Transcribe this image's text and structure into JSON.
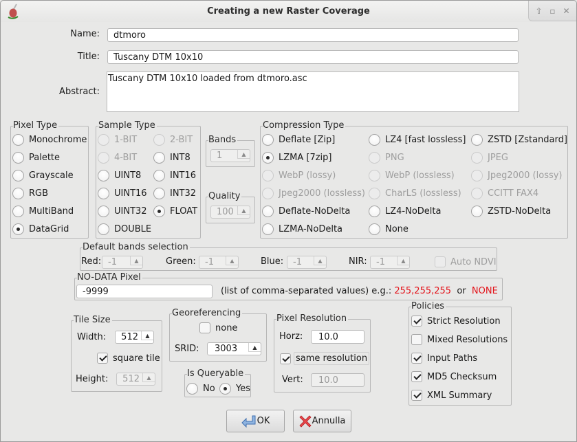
{
  "window": {
    "title": "Creating a new Raster Coverage",
    "controls": [
      "up-icon",
      "maximize-icon",
      "close-icon"
    ]
  },
  "form": {
    "name_label": "Name:",
    "name_value": "dtmoro",
    "title_label": "Title:",
    "title_value": "Tuscany DTM 10x10",
    "abstract_label": "Abstract:",
    "abstract_value": "Tuscany DTM 10x10 loaded from dtmoro.asc"
  },
  "pixel_type": {
    "legend": "Pixel Type",
    "options": [
      {
        "label": "Monochrome",
        "selected": false,
        "enabled": true
      },
      {
        "label": "Palette",
        "selected": false,
        "enabled": true
      },
      {
        "label": "Grayscale",
        "selected": false,
        "enabled": true
      },
      {
        "label": "RGB",
        "selected": false,
        "enabled": true
      },
      {
        "label": "MultiBand",
        "selected": false,
        "enabled": true
      },
      {
        "label": "DataGrid",
        "selected": true,
        "enabled": true
      }
    ]
  },
  "sample_type": {
    "legend": "Sample Type",
    "options": [
      {
        "label": "1-BIT",
        "selected": false,
        "enabled": false
      },
      {
        "label": "2-BIT",
        "selected": false,
        "enabled": false
      },
      {
        "label": "4-BIT",
        "selected": false,
        "enabled": false
      },
      {
        "label": "INT8",
        "selected": false,
        "enabled": true
      },
      {
        "label": "UINT8",
        "selected": false,
        "enabled": true
      },
      {
        "label": "INT16",
        "selected": false,
        "enabled": true
      },
      {
        "label": "UINT16",
        "selected": false,
        "enabled": true
      },
      {
        "label": "INT32",
        "selected": false,
        "enabled": true
      },
      {
        "label": "UINT32",
        "selected": false,
        "enabled": true
      },
      {
        "label": "FLOAT",
        "selected": true,
        "enabled": true
      },
      {
        "label": "DOUBLE",
        "selected": false,
        "enabled": true
      }
    ]
  },
  "bands": {
    "legend": "Bands",
    "value": "1"
  },
  "quality": {
    "legend": "Quality",
    "value": "100"
  },
  "compression": {
    "legend": "Compression Type",
    "options": [
      {
        "label": "Deflate [Zip]",
        "selected": false,
        "enabled": true
      },
      {
        "label": "LZ4 [fast lossless]",
        "selected": false,
        "enabled": true
      },
      {
        "label": "ZSTD [Zstandard]",
        "selected": false,
        "enabled": true
      },
      {
        "label": "LZMA [7zip]",
        "selected": true,
        "enabled": true
      },
      {
        "label": "PNG",
        "selected": false,
        "enabled": false
      },
      {
        "label": "JPEG",
        "selected": false,
        "enabled": false
      },
      {
        "label": "WebP (lossy)",
        "selected": false,
        "enabled": false
      },
      {
        "label": "WebP (lossless)",
        "selected": false,
        "enabled": false
      },
      {
        "label": "Jpeg2000 (lossy)",
        "selected": false,
        "enabled": false
      },
      {
        "label": "Jpeg2000 (lossless)",
        "selected": false,
        "enabled": false
      },
      {
        "label": "CharLS (lossless)",
        "selected": false,
        "enabled": false
      },
      {
        "label": "CCITT FAX4",
        "selected": false,
        "enabled": false
      },
      {
        "label": "Deflate-NoDelta",
        "selected": false,
        "enabled": true
      },
      {
        "label": "LZ4-NoDelta",
        "selected": false,
        "enabled": true
      },
      {
        "label": "ZSTD-NoDelta",
        "selected": false,
        "enabled": true
      },
      {
        "label": "LZMA-NoDelta",
        "selected": false,
        "enabled": true
      },
      {
        "label": "None",
        "selected": false,
        "enabled": true
      }
    ]
  },
  "default_bands": {
    "legend": "Default bands selection",
    "red_label": "Red:",
    "red_value": "-1",
    "green_label": "Green:",
    "green_value": "-1",
    "blue_label": "Blue:",
    "blue_value": "-1",
    "nir_label": "NIR:",
    "nir_value": "-1",
    "auto_ndvi_label": "Auto NDVI",
    "auto_ndvi_checked": false
  },
  "nodata": {
    "legend": "NO-DATA Pixel",
    "value": "-9999",
    "hint": "(list of comma-separated values) e.g.:",
    "example1": "255,255,255",
    "or_text": "or",
    "example2": "NONE",
    "highlight_color": "#e3141b"
  },
  "tile_size": {
    "legend": "Tile Size",
    "width_label": "Width:",
    "width_value": "512",
    "square_label": "square tile",
    "square_checked": true,
    "height_label": "Height:",
    "height_value": "512"
  },
  "georef": {
    "legend": "Georeferencing",
    "none_label": "none",
    "none_checked": false,
    "srid_label": "SRID:",
    "srid_value": "3003"
  },
  "queryable": {
    "legend": "Is Queryable",
    "no_label": "No",
    "yes_label": "Yes",
    "selected": "Yes"
  },
  "resolution": {
    "legend": "Pixel Resolution",
    "horz_label": "Horz:",
    "horz_value": "10.0",
    "same_label": "same resolution",
    "same_checked": true,
    "vert_label": "Vert:",
    "vert_value": "10.0"
  },
  "policies": {
    "legend": "Policies",
    "items": [
      {
        "label": "Strict Resolution",
        "checked": true
      },
      {
        "label": "Mixed Resolutions",
        "checked": false
      },
      {
        "label": "Input Paths",
        "checked": true
      },
      {
        "label": "MD5 Checksum",
        "checked": true
      },
      {
        "label": "XML Summary",
        "checked": true
      }
    ]
  },
  "buttons": {
    "ok_label": "OK",
    "cancel_label": "Annulla"
  }
}
